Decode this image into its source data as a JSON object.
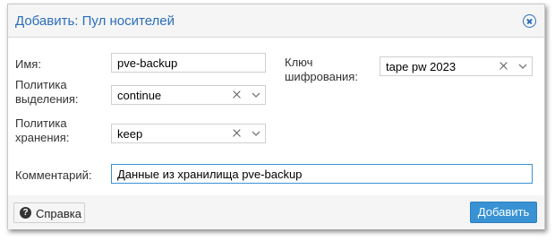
{
  "dialog": {
    "title": "Добавить: Пул носителей",
    "close_icon": "close-circle-icon"
  },
  "form": {
    "name": {
      "label": "Имя:",
      "value": "pve-backup"
    },
    "allocation": {
      "label_line1": "Политика",
      "label_line2": "выделения:",
      "value": "continue"
    },
    "retention": {
      "label_line1": "Политика",
      "label_line2": "хранения:",
      "value": "keep"
    },
    "encryption": {
      "label_line1": "Ключ",
      "label_line2": "шифрования:",
      "value": "tape pw 2023"
    },
    "comment": {
      "label": "Комментарий:",
      "value": "Данные из хранилища pve-backup"
    }
  },
  "footer": {
    "help_label": "Справка",
    "help_icon": "question-circle-icon",
    "add_label": "Добавить"
  },
  "colors": {
    "accent": "#3892d4",
    "title": "#2a6ebb"
  }
}
